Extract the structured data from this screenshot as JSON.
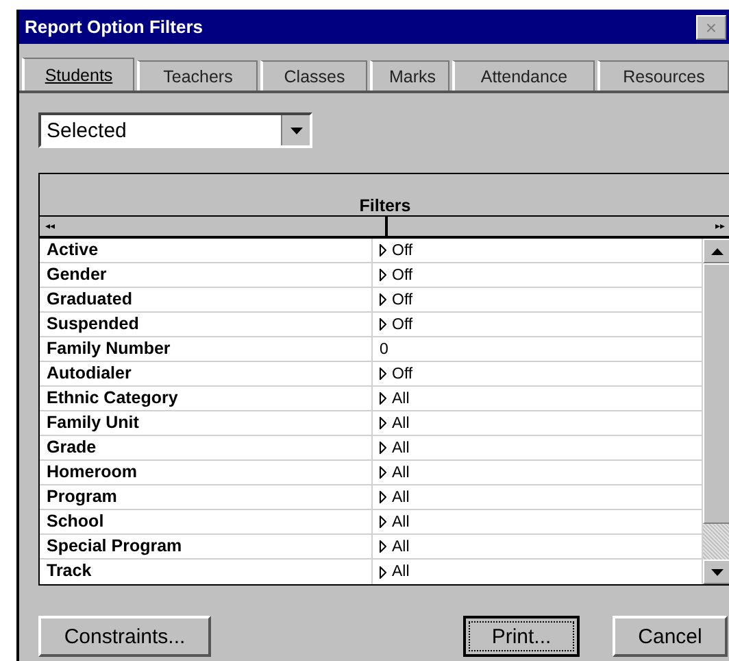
{
  "window": {
    "title": "Report Option Filters",
    "close": "×"
  },
  "tabs": [
    {
      "label": "Students",
      "selected": true
    },
    {
      "label": "Teachers",
      "selected": false
    },
    {
      "label": "Classes",
      "selected": false
    },
    {
      "label": "Marks",
      "selected": false
    },
    {
      "label": "Attendance",
      "selected": false
    },
    {
      "label": "Resources",
      "selected": false
    }
  ],
  "selection_dropdown": {
    "value": "Selected"
  },
  "table": {
    "title": "Filters",
    "scroll_left": "◂◂",
    "scroll_right": "▸▸",
    "rows": [
      {
        "name": "Active",
        "kind": "choice",
        "value": "Off"
      },
      {
        "name": "Gender",
        "kind": "choice",
        "value": "Off"
      },
      {
        "name": "Graduated",
        "kind": "choice",
        "value": "Off"
      },
      {
        "name": "Suspended",
        "kind": "choice",
        "value": "Off"
      },
      {
        "name": "Family Number",
        "kind": "text",
        "value": "0"
      },
      {
        "name": "Autodialer",
        "kind": "choice",
        "value": "Off"
      },
      {
        "name": "Ethnic Category",
        "kind": "choice",
        "value": "All"
      },
      {
        "name": "Family Unit",
        "kind": "choice",
        "value": "All"
      },
      {
        "name": "Grade",
        "kind": "choice",
        "value": "All"
      },
      {
        "name": "Homeroom",
        "kind": "choice",
        "value": "All"
      },
      {
        "name": "Program",
        "kind": "choice",
        "value": "All"
      },
      {
        "name": "School",
        "kind": "choice",
        "value": "All"
      },
      {
        "name": "Special Program",
        "kind": "choice",
        "value": "All"
      },
      {
        "name": "Track",
        "kind": "choice",
        "value": "All"
      }
    ]
  },
  "buttons": [
    {
      "label": "Constraints...",
      "default": false
    },
    {
      "label": "Print...",
      "default": true
    },
    {
      "label": "Cancel",
      "default": false
    }
  ]
}
